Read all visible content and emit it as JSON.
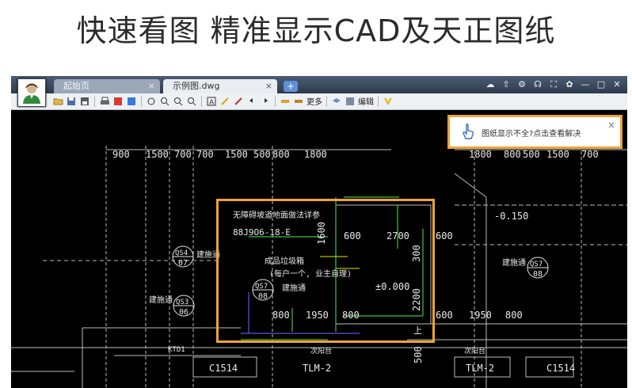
{
  "headline": "快速看图  精准显示CAD及天正图纸",
  "app": {
    "tabs": [
      {
        "label": "起始页",
        "close": "×"
      },
      {
        "label": "示例图.dwg",
        "close": "×"
      }
    ],
    "new_tab_label": "+",
    "window_controls": [
      "☁",
      "⇧",
      "⚙",
      "☊",
      "⛶",
      "✿",
      "—",
      "□",
      "✕"
    ],
    "toolbar": {
      "more_label": "更多",
      "edit_label": "编辑"
    },
    "notice": {
      "text": "图纸显示不全?点击查看解决",
      "close": "×"
    },
    "drawing": {
      "top_dims_left": [
        "900",
        "1500",
        "700",
        "700",
        "1500",
        "500",
        "800",
        "1800"
      ],
      "top_dims_right": [
        "1800",
        "800",
        "500",
        "1500",
        "700"
      ],
      "labels": {
        "wheelchair": "无障碍坡道地面做法详参",
        "ref": "88J9O6-18-E",
        "dim_1600": "1600",
        "dim_600a": "600",
        "dim_2700": "2700",
        "dim_600b": "600",
        "dim_300": "300",
        "trash": "成品垃圾箱",
        "trash_note": "(每户一个, 业主自理)",
        "level_0": "±0.000",
        "level_neg": "-0.150",
        "dim_2200": "2200",
        "dim_800a": "800",
        "dim_1950a": "1950",
        "dim_800b": "800",
        "dim_600c": "600",
        "dim_1950b": "1950",
        "dim_800c": "800",
        "wall_a": "建施通",
        "wall_b": "建施通",
        "wall_c": "建施通",
        "wall_d": "建施通",
        "qs4_top": "QS4",
        "qs4_bot": "07",
        "qs3_top": "QS3",
        "qs3_bot": "06",
        "qs7a_top": "QS7",
        "qs7a_bot": "08",
        "qs7b_top": "QS7",
        "qs7b_bot": "08",
        "ktd1": "KTD1",
        "c1514a": "C1514",
        "c1514b": "C1514",
        "tlm2a": "TLM-2",
        "tlm2b": "TLM-2",
        "balcony_a": "次阳台",
        "balcony_b": "次阳台",
        "dim_500": "500",
        "up": "上"
      }
    }
  }
}
